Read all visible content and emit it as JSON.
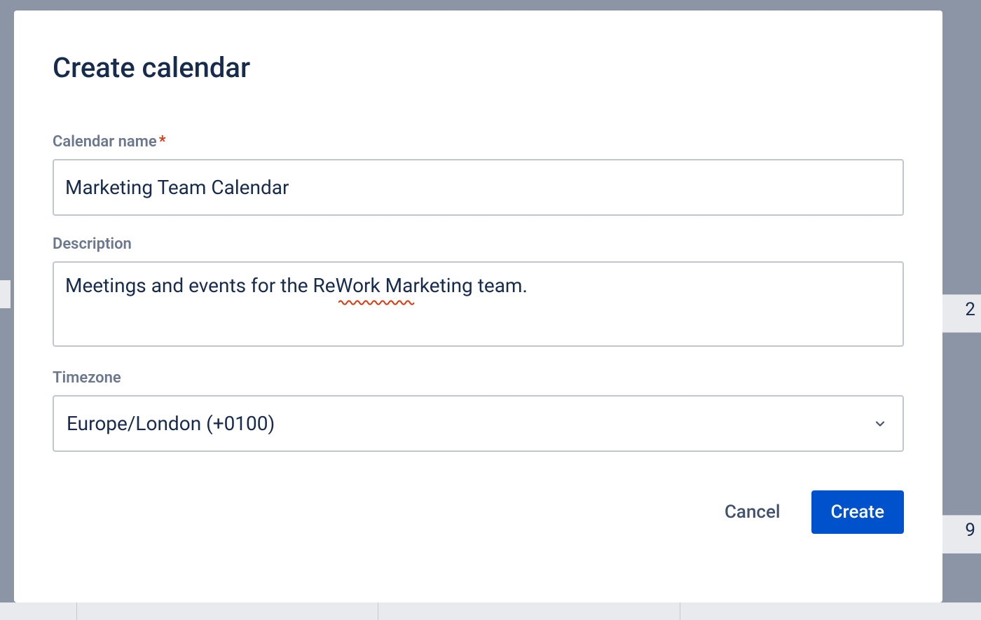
{
  "modal": {
    "title": "Create calendar",
    "fields": {
      "calendar_name": {
        "label": "Calendar name",
        "required": true,
        "value": "Marketing Team Calendar"
      },
      "description": {
        "label": "Description",
        "value": "Meetings and events for the ReWork Marketing team."
      },
      "timezone": {
        "label": "Timezone",
        "value": "Europe/London (+0100)"
      }
    },
    "buttons": {
      "cancel": "Cancel",
      "create": "Create"
    }
  },
  "background": {
    "cell_right_1": "2",
    "cell_right_2": "9"
  }
}
